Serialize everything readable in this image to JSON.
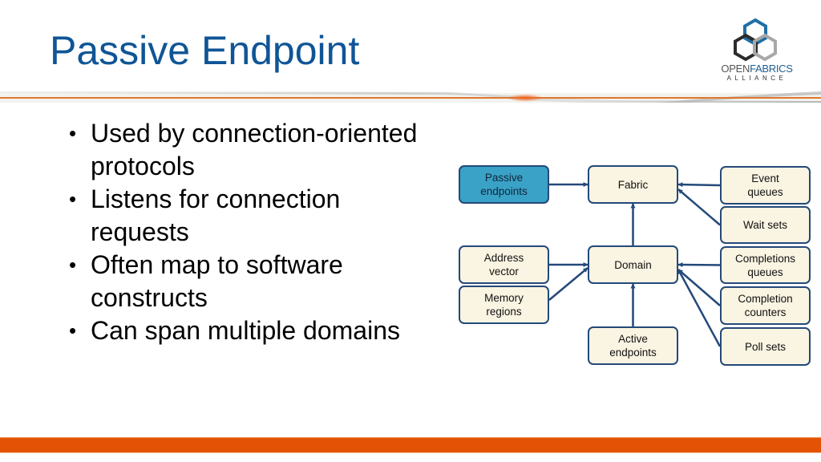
{
  "slide": {
    "title": "Passive Endpoint",
    "title_color": "#0f5596",
    "accent_color": "#e35205"
  },
  "logo": {
    "name": "OpenFabrics Alliance logo",
    "text_open": "OPEN",
    "text_fabrics": "FABRICS",
    "text_alliance": "ALLIANCE"
  },
  "bullets": [
    {
      "text": "Used by connection-oriented protocols"
    },
    {
      "text": "Listens for connection requests"
    },
    {
      "text": "Often map to software constructs"
    },
    {
      "text": "Can span multiple domains"
    }
  ],
  "bullet_glyph": "•",
  "diagram": {
    "node_fill": "#faf4e2",
    "highlight_fill": "#3aa2c6",
    "edge_color": "#24497a",
    "nodes": {
      "passive_endpoints": {
        "label": "Passive\nendpoints",
        "highlighted": true
      },
      "fabric": {
        "label": "Fabric"
      },
      "event_queues": {
        "label": "Event\nqueues"
      },
      "wait_sets": {
        "label": "Wait sets"
      },
      "address_vector": {
        "label": "Address\nvector"
      },
      "domain": {
        "label": "Domain"
      },
      "completions_queues": {
        "label": "Completions\nqueues"
      },
      "memory_regions": {
        "label": "Memory\nregions"
      },
      "completion_counters": {
        "label": "Completion\ncounters"
      },
      "active_endpoints": {
        "label": "Active\nendpoints"
      },
      "poll_sets": {
        "label": "Poll sets"
      }
    },
    "edges": [
      {
        "from": "passive_endpoints",
        "to": "fabric"
      },
      {
        "from": "event_queues",
        "to": "fabric"
      },
      {
        "from": "wait_sets",
        "to": "fabric"
      },
      {
        "from": "domain",
        "to": "fabric"
      },
      {
        "from": "address_vector",
        "to": "domain"
      },
      {
        "from": "memory_regions",
        "to": "domain"
      },
      {
        "from": "completions_queues",
        "to": "domain"
      },
      {
        "from": "completion_counters",
        "to": "domain"
      },
      {
        "from": "poll_sets",
        "to": "domain"
      },
      {
        "from": "active_endpoints",
        "to": "domain"
      }
    ]
  }
}
